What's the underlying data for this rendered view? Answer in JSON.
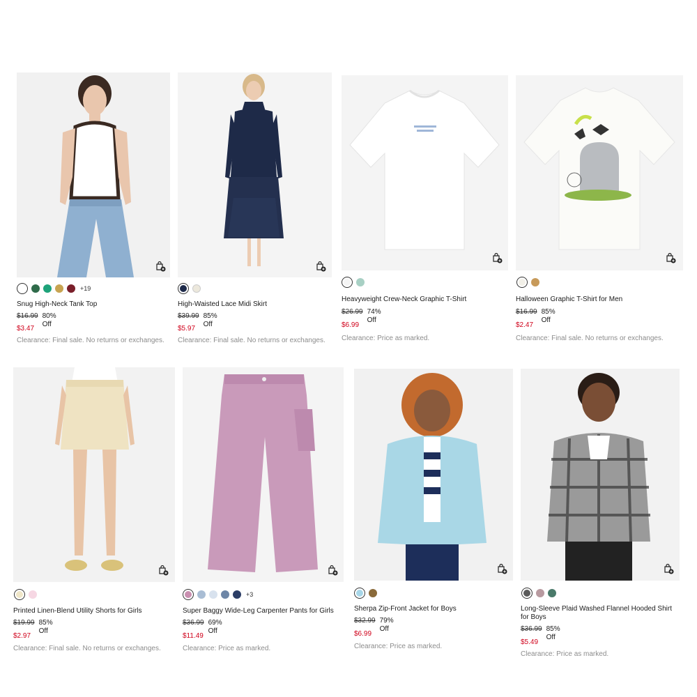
{
  "products": [
    {
      "title": "Snug High-Neck Tank Top",
      "price_was": "$16.99",
      "discount": "80% Off",
      "price_now": "$3.47",
      "note": "Clearance: Final sale. No returns or exchanges.",
      "more_colors": "+19",
      "swatch_colors": [
        "#ffffff",
        "#2f6b4a",
        "#1ea37a",
        "#c8a451",
        "#7a1f2a"
      ],
      "image": "model-white-tank-jeans"
    },
    {
      "title": "High-Waisted Lace Midi Skirt",
      "price_was": "$39.99",
      "discount": "85% Off",
      "price_now": "$5.97",
      "note": "Clearance: Final sale. No returns or exchanges.",
      "swatch_colors": [
        "#1d2a4a",
        "#ece8dc"
      ],
      "image": "model-navy-lace-skirt"
    },
    {
      "title": "Heavyweight Crew-Neck Graphic T-Shirt",
      "price_was": "$26.99",
      "discount": "74% Off",
      "price_now": "$6.99",
      "note": "Clearance: Price as marked.",
      "swatch_colors": [
        "#f5f5f5",
        "#a8d0c4"
      ],
      "image": "white-tshirt"
    },
    {
      "title": "Halloween Graphic T-Shirt for Men",
      "price_was": "$16.99",
      "discount": "85% Off",
      "price_now": "$2.47",
      "note": "Clearance: Final sale. No returns or exchanges.",
      "swatch_colors": [
        "#f2f0e8",
        "#c79a5a"
      ],
      "image": "halloween-tshirt"
    },
    {
      "title": "Printed Linen-Blend Utility Shorts for Girls",
      "price_was": "$19.99",
      "discount": "85% Off",
      "price_now": "$2.97",
      "note": "Clearance: Final sale. No returns or exchanges.",
      "swatch_colors": [
        "#efe6c8",
        "#f6d7e3"
      ],
      "image": "girl-linen-shorts"
    },
    {
      "title": "Super Baggy Wide-Leg Carpenter Pants for Girls",
      "price_was": "$36.99",
      "discount": "69% Off",
      "price_now": "$11.49",
      "note": "Clearance: Price as marked.",
      "more_colors": "+3",
      "swatch_colors": [
        "#c98fb0",
        "#a9bdd4",
        "#d8e2ee",
        "#6d86a6",
        "#2c3e66"
      ],
      "image": "pink-carpenter-pants"
    },
    {
      "title": "Sherpa Zip-Front Jacket for Boys",
      "price_was": "$32.99",
      "discount": "79% Off",
      "price_now": "$6.99",
      "note": "Clearance: Price as marked.",
      "swatch_colors": [
        "#a7d6e8",
        "#8a6a3a"
      ],
      "image": "boy-blue-sherpa-jacket"
    },
    {
      "title": "Long-Sleeve Plaid Washed Flannel Hooded Shirt for Boys",
      "price_was": "$36.99",
      "discount": "85% Off",
      "price_now": "$5.49",
      "note": "Clearance: Price as marked.",
      "swatch_colors": [
        "#5a5a5a",
        "#b89aa0",
        "#4a7a6a"
      ],
      "image": "boy-plaid-flannel"
    }
  ],
  "icons": {
    "add_to_bag": "shopping-bag-plus-icon"
  }
}
